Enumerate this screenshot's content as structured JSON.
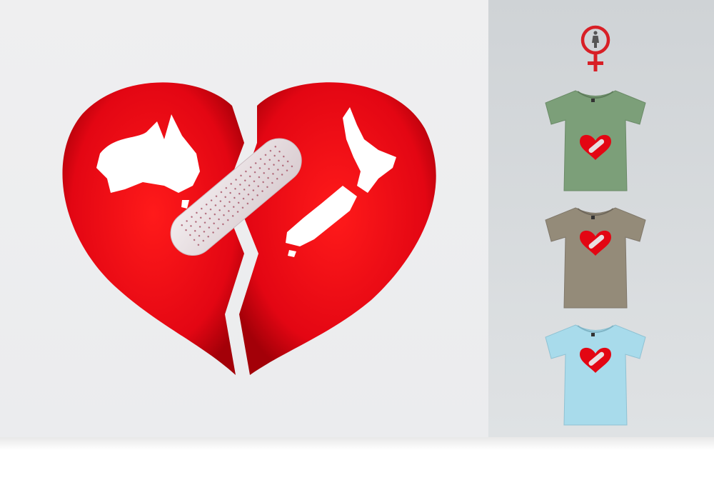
{
  "hero": {
    "icon": "broken-heart-bandage-australia-new-zealand",
    "heart_color": "#e30613",
    "map_color": "#ffffff",
    "bandage_color": "#e8dde0"
  },
  "gender_filter": {
    "icon": "female-symbol-icon",
    "color": "#d81f26"
  },
  "shirts": [
    {
      "icon": "tshirt-green-icon",
      "color": "#7c9f79"
    },
    {
      "icon": "tshirt-khaki-icon",
      "color": "#948b79"
    },
    {
      "icon": "tshirt-lightblue-icon",
      "color": "#a8dbeb"
    }
  ]
}
